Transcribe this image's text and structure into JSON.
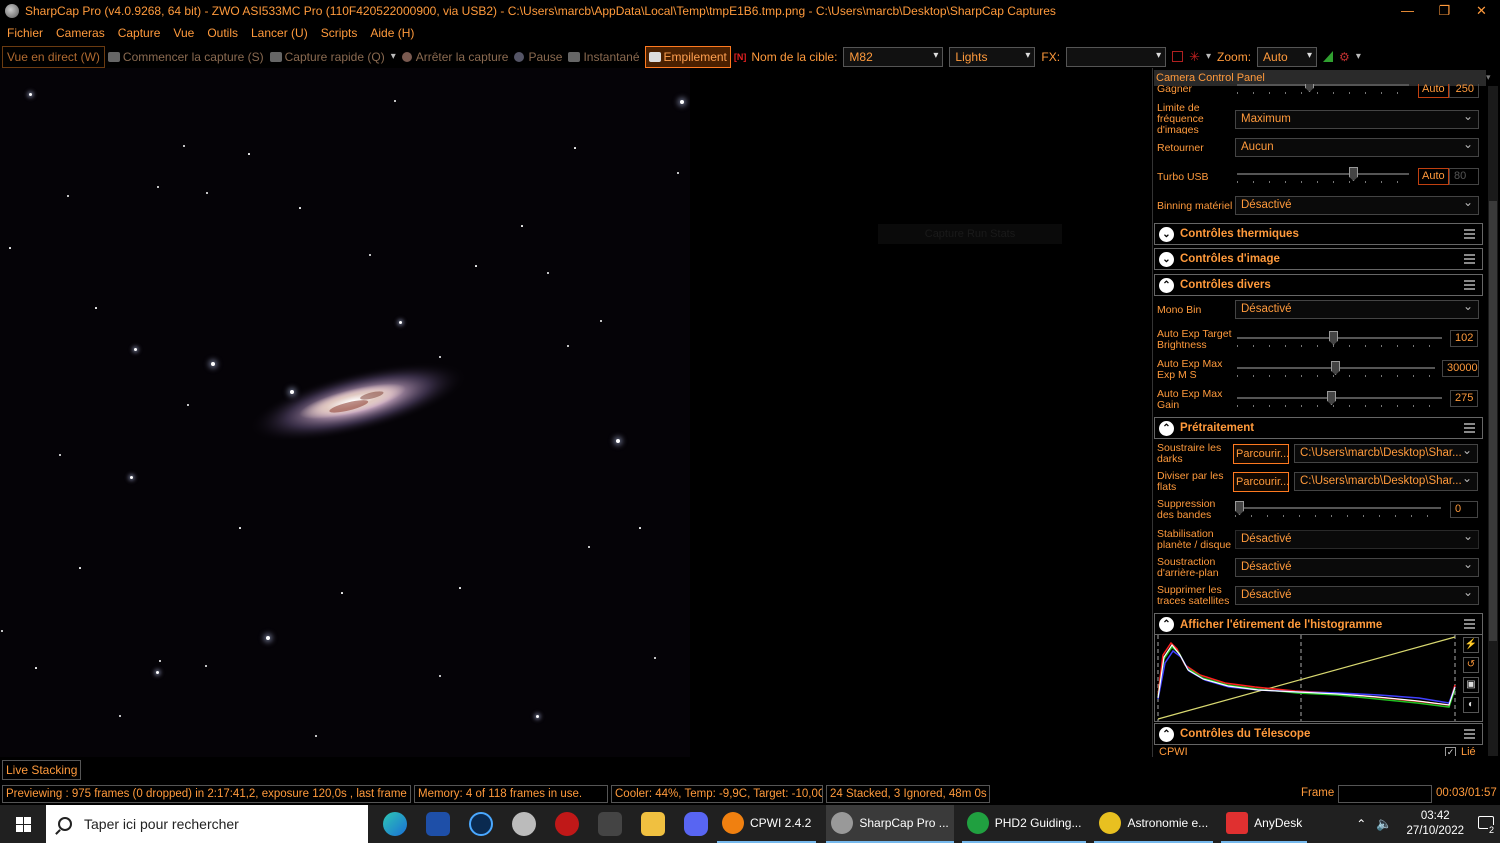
{
  "window": {
    "title": "SharpCap Pro (v4.0.9268, 64 bit) - ZWO ASI533MC Pro (110F420522000900, via USB2) - C:\\Users\\marcb\\AppData\\Local\\Temp\\tmpE1B6.tmp.png - C:\\Users\\marcb\\Desktop\\SharpCap Captures",
    "minimize": "—",
    "maximize": "❐",
    "close": "✕"
  },
  "menu": [
    "Fichier",
    "Cameras",
    "Capture",
    "Vue",
    "Outils",
    "Lancer (U)",
    "Scripts",
    "Aide (H)"
  ],
  "toolbar": {
    "live_view": "Vue en direct (W)",
    "start_capture": "Commencer la capture (S)",
    "quick_capture": "Capture rapide (Q)",
    "stop_capture": "Arrêter la capture",
    "pause": "Pause",
    "snapshot": "Instantané",
    "stacking": "Empilement",
    "target_label": "Nom de la cible:",
    "target_value": "M82",
    "frame_type": "Lights",
    "fx_label": "FX:",
    "fx_value": "",
    "zoom_label": "Zoom:",
    "zoom_value": "Auto"
  },
  "viewer": {
    "overlay_text": "Capture Run Stats"
  },
  "panel": {
    "title": "Camera Control Panel",
    "gain": {
      "label": "Gagner",
      "auto": "Auto",
      "value": "250"
    },
    "framerate": {
      "label": "Limite de fréquence d'images",
      "value": "Maximum"
    },
    "flip": {
      "label": "Retourner",
      "value": "Aucun"
    },
    "turbo": {
      "label": "Turbo USB",
      "auto": "Auto",
      "value": "80",
      "level": 0.8
    },
    "binning": {
      "label": "Binning matériel",
      "value": "Désactivé"
    },
    "sections": {
      "thermal": "Contrôles thermiques",
      "image": "Contrôles d'image",
      "misc": "Contrôles divers",
      "preproc": "Prétraitement",
      "histogram": "Afficher l'étirement de l'histogramme",
      "telescope": "Contrôles du Télescope"
    },
    "mono_bin": {
      "label": "Mono Bin",
      "value": "Désactivé"
    },
    "auto_exp_target": {
      "label": "Auto Exp Target Brightness",
      "value": "102"
    },
    "auto_exp_max_exp": {
      "label": "Auto Exp Max Exp M S",
      "value": "30000"
    },
    "auto_exp_max_gain": {
      "label": "Auto Exp Max Gain",
      "value": "275"
    },
    "darks": {
      "label": "Soustraire les darks",
      "browse": "Parcourir...",
      "path": "C:\\Users\\marcb\\Desktop\\Shar..."
    },
    "flats": {
      "label": "Diviser par les flats",
      "browse": "Parcourir...",
      "path": "C:\\Users\\marcb\\Desktop\\Shar..."
    },
    "banding": {
      "label": "Suppression des bandes",
      "value": "0"
    },
    "stabilisation": {
      "label": "Stabilisation planète / disque",
      "value": "Désactivé"
    },
    "background": {
      "label": "Soustraction d'arrière-plan",
      "value": "Désactivé"
    },
    "satellites": {
      "label": "Supprimer les traces satellites",
      "value": "Désactivé"
    },
    "telescope_item": "CPWI",
    "telescope_linked": "Lié"
  },
  "live_stacking": "Live Stacking",
  "status": {
    "preview": "Previewing : 975 frames (0 dropped) in 2:17:41,2, exposure 120,0s , last frame 120",
    "memory": "Memory: 4 of 118 frames in use.",
    "cooler": "Cooler: 44%, Temp: -9,9C, Target: -10,0C",
    "stacked": "24 Stacked, 3 Ignored, 48m 0s",
    "frame_label": "Frame :",
    "frame_time": "00:03/01:57"
  },
  "taskbar": {
    "search_placeholder": "Taper ici pour rechercher",
    "apps": [
      {
        "label": "CPWI 2.4.2",
        "color": "#f08010"
      },
      {
        "label": "SharpCap Pro ...",
        "color": "#999999"
      },
      {
        "label": "PHD2 Guiding...",
        "color": "#20a040"
      },
      {
        "label": "Astronomie e...",
        "color": "#e8c020"
      },
      {
        "label": "AnyDesk",
        "color": "#e03030"
      }
    ],
    "time": "03:42",
    "date": "27/10/2022",
    "notifications": "2"
  },
  "colors": {
    "accent": "#ff9a3c",
    "histogram_red": "#ff2020",
    "histogram_green": "#20c020",
    "histogram_blue": "#4040ff",
    "curve": "#d8d870"
  }
}
